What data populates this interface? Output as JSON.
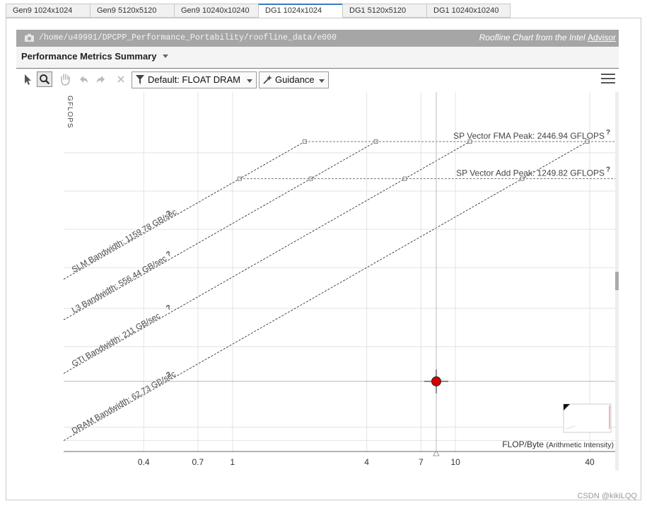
{
  "tabs": [
    {
      "label": "Gen9 1024x1024",
      "active": false
    },
    {
      "label": "Gen9 5120x5120",
      "active": false
    },
    {
      "label": "Gen9 10240x10240",
      "active": false
    },
    {
      "label": "DG1 1024x1024",
      "active": true
    },
    {
      "label": "DG1 5120x5120",
      "active": false
    },
    {
      "label": "DG1 10240x10240",
      "active": false
    }
  ],
  "header": {
    "path": "/home/u49991/DPCPP_Performance_Portability/roofline_data/e000",
    "credit_prefix": "Roofline Chart from the Intel",
    "credit_link": "Advisor"
  },
  "summary": {
    "title": "Performance Metrics Summary"
  },
  "toolbar": {
    "filter_label": "Default: FLOAT DRAM",
    "guidance_label": "Guidance",
    "icons": [
      "pointer-icon",
      "zoom-icon",
      "pan-hand-icon",
      "undo-icon",
      "redo-icon",
      "clear-icon",
      "filter-icon",
      "wand-icon",
      "menu-icon"
    ]
  },
  "chart_data": {
    "type": "scatter",
    "title": "",
    "xlabel": "FLOP/Byte",
    "xlabel_suffix": "(Arithmetic Intensity)",
    "ylabel": "GFLOPS",
    "x_scale": "log",
    "y_scale": "log",
    "xlim": [
      0.175,
      52
    ],
    "ylim": [
      9,
      6000
    ],
    "x_ticks": [
      0.4,
      0.7,
      1,
      4,
      7,
      10,
      40
    ],
    "grid": true,
    "compute_roofs": [
      {
        "name": "SP Vector FMA Peak",
        "label": "SP Vector FMA Peak: 2446.94 GFLOPS",
        "value": 2446.94
      },
      {
        "name": "SP Vector Add Peak",
        "label": "SP Vector Add Peak: 1249.82 GFLOPS",
        "value": 1249.82
      }
    ],
    "memory_roofs": [
      {
        "name": "SLM Bandwidth",
        "label": "SLM Bandwidth: 1159.78 GB/sec",
        "value": 1159.78
      },
      {
        "name": "L3 Bandwidth",
        "label": "L3 Bandwidth: 556.44 GB/sec",
        "value": 556.44
      },
      {
        "name": "GTI Bandwidth",
        "label": "GTI Bandwidth: 211 GB/sec",
        "value": 211
      },
      {
        "name": "DRAM Bandwidth",
        "label": "DRAM Bandwidth: 62.73 GB/sec",
        "value": 62.73
      }
    ],
    "points": [
      {
        "x": 8.2,
        "y": 32,
        "color": "#d40000"
      }
    ],
    "help_marker": "?"
  },
  "watermark": "CSDN @kikiLQQ"
}
